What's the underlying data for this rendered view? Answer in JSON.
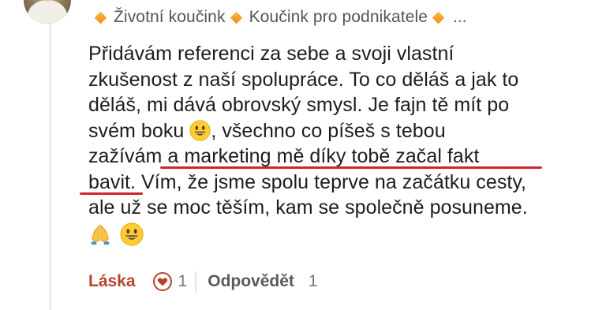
{
  "header": {
    "tags": [
      {
        "label": "Životní koučink",
        "icon": "orange-diamond-icon"
      },
      {
        "label": "Koučink pro podnikatele",
        "icon": "orange-diamond-icon"
      }
    ],
    "overflow": "..."
  },
  "comment": {
    "lines": [
      {
        "text": "Přidávám referenci za sebe a svoji vlastní"
      },
      {
        "text": "zkušenost z naší spolupráce. To co děláš a jak to"
      },
      {
        "text": "děláš, mi dává obrovský smysl.  Je fajn tě mít po"
      },
      {
        "before": "svém boku ",
        "after": ", všechno co píšeš s tebou",
        "emoji": "grinning-face-emoji"
      },
      {
        "text": "zažívám a marketing mě díky tobě začal fakt"
      },
      {
        "text": "bavit. Vím, že jsme spolu teprve na začátku cesty,"
      },
      {
        "text": "ale už se moc těším, kam se společně posuneme."
      }
    ],
    "final_emojis": [
      "folded-hands-emoji",
      "grinning-face-emoji"
    ],
    "highlight_color": "#d0242a"
  },
  "actions": {
    "love_label": "Láska",
    "love_count": "1",
    "reply_label": "Odpovědět",
    "reply_count": "1"
  },
  "colors": {
    "accent": "#b5432c",
    "diamond": "#f08c14",
    "underline": "#d0242a"
  }
}
